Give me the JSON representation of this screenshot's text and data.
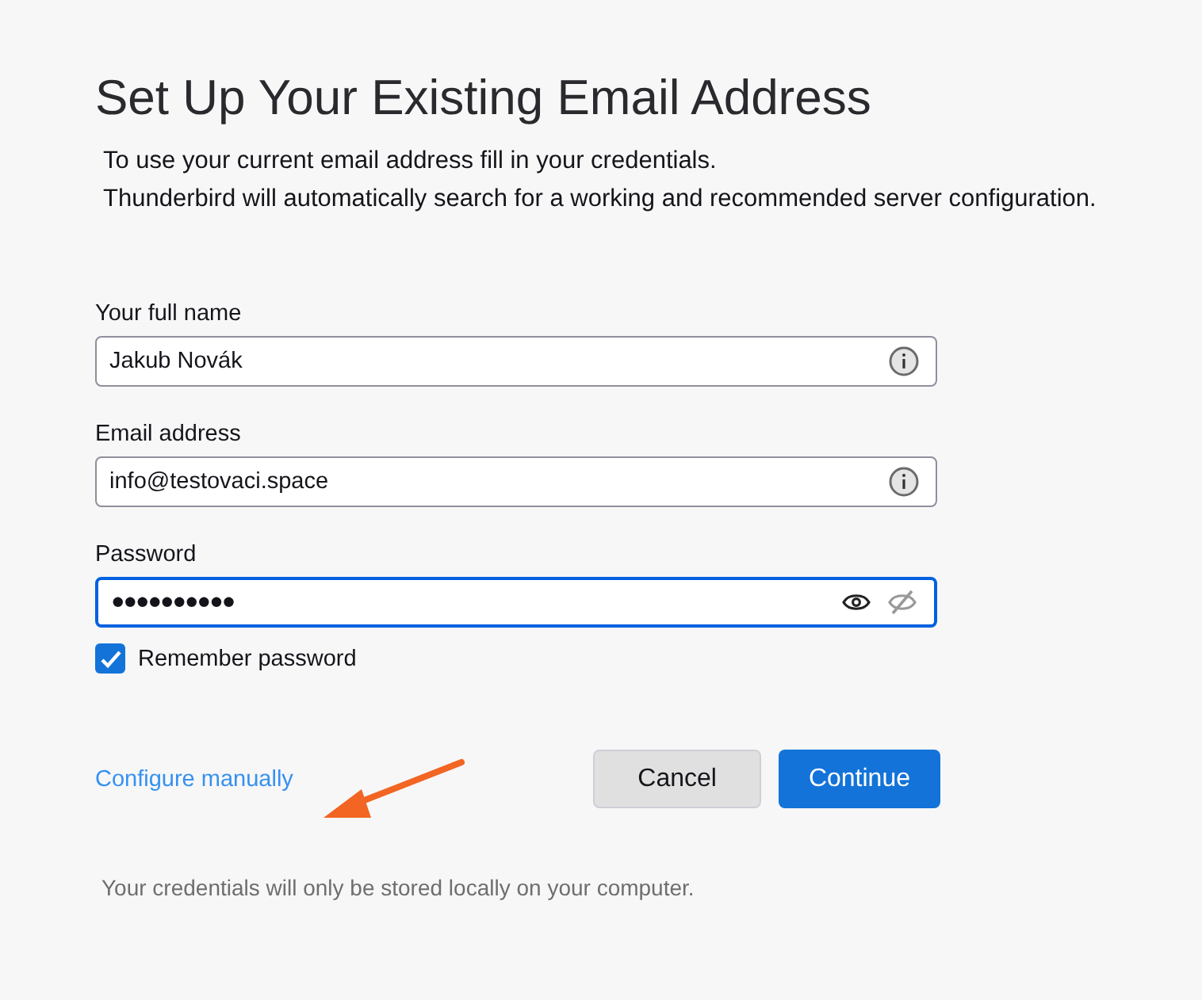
{
  "title": "Set Up Your Existing Email Address",
  "description": [
    "To use your current email address fill in your credentials.",
    "Thunderbird will automatically search for a working and recommended server configuration."
  ],
  "fields": [
    {
      "kind": "info",
      "label": "Your full name",
      "value": "Jakub Novák",
      "focused": false
    },
    {
      "kind": "info",
      "label": "Email address",
      "value": "info@testovaci.space",
      "focused": false
    },
    {
      "kind": "password",
      "label": "Password",
      "value": "●●●●●●●●●●",
      "focused": true
    }
  ],
  "remember": {
    "label": "Remember password",
    "checked": true
  },
  "link": "Configure manually",
  "buttons": [
    {
      "kind": "secondary",
      "label": "Cancel"
    },
    {
      "kind": "primary",
      "label": "Continue"
    }
  ],
  "footer": "Your credentials will only be stored locally on your computer."
}
